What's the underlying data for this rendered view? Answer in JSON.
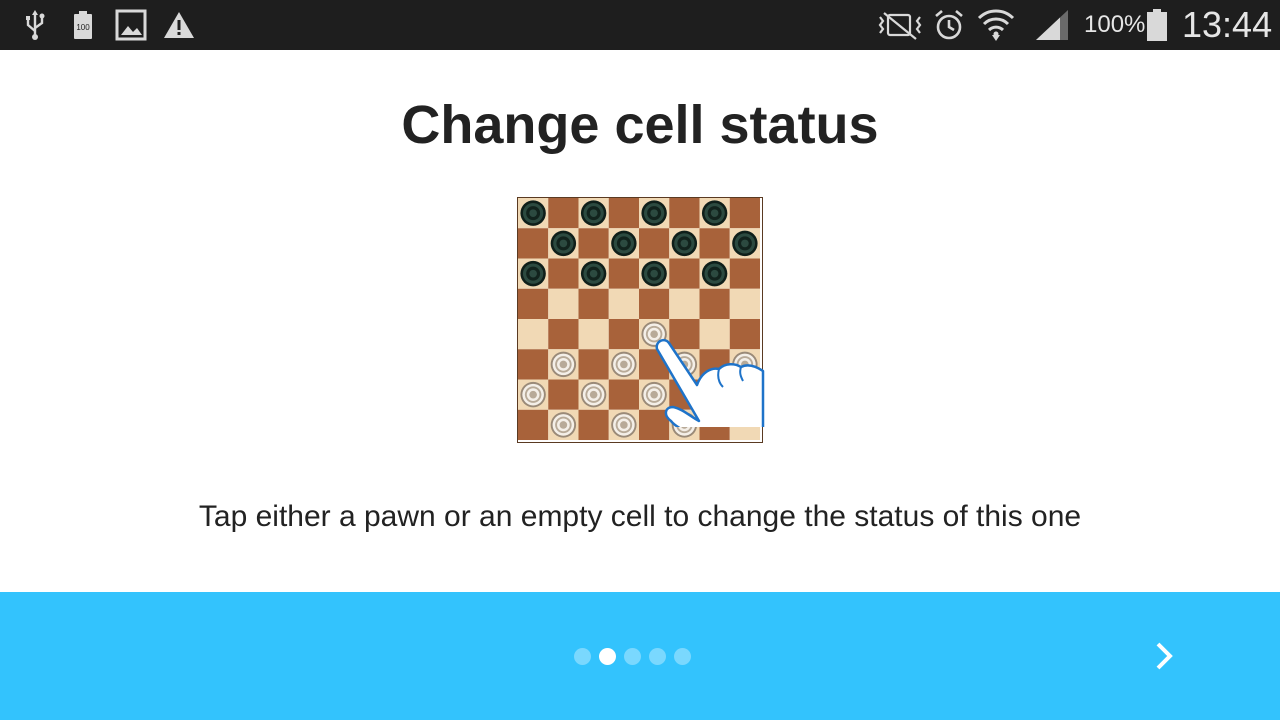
{
  "status_bar": {
    "icons_left": [
      "usb-icon",
      "battery-100-notification-icon",
      "image-icon",
      "warning-icon"
    ],
    "icons_right": [
      "vibrate-icon",
      "alarm-icon",
      "wifi-icon",
      "signal-icon",
      "battery-icon"
    ],
    "battery_percent": "100%",
    "time": "13:44"
  },
  "main": {
    "title": "Change cell status",
    "description": "Tap either a pawn or an empty cell to change the status of this one",
    "illustration": {
      "board_size": 8,
      "dark_square_color": "#a8623a",
      "light_square_color": "#f1d9b5",
      "black_pawns": [
        [
          0,
          0
        ],
        [
          0,
          2
        ],
        [
          0,
          4
        ],
        [
          0,
          6
        ],
        [
          1,
          1
        ],
        [
          1,
          3
        ],
        [
          1,
          5
        ],
        [
          1,
          7
        ],
        [
          2,
          0
        ],
        [
          2,
          2
        ],
        [
          2,
          4
        ],
        [
          2,
          6
        ]
      ],
      "white_pawns": [
        [
          4,
          4
        ],
        [
          5,
          1
        ],
        [
          5,
          3
        ],
        [
          5,
          5
        ],
        [
          5,
          7
        ],
        [
          6,
          0
        ],
        [
          6,
          2
        ],
        [
          6,
          4
        ],
        [
          7,
          1
        ],
        [
          7,
          3
        ],
        [
          7,
          5
        ]
      ],
      "hand_icon": "tap-hand-icon"
    }
  },
  "footer": {
    "background": "#33c3fd",
    "page_count": 5,
    "active_page": 2,
    "next_icon": "chevron-right-icon"
  }
}
